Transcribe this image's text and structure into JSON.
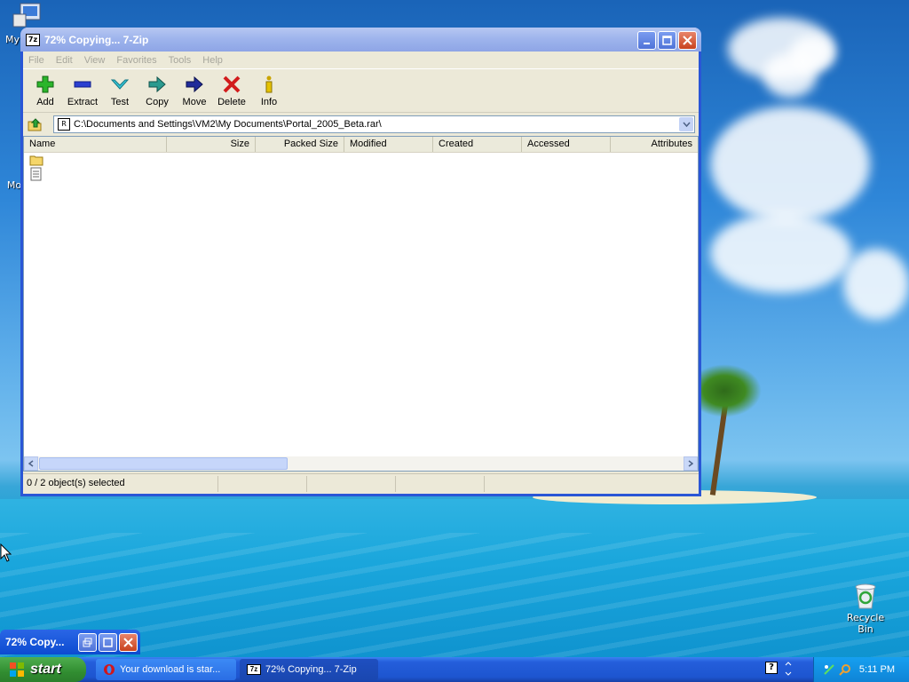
{
  "window": {
    "title": "72% Copying... 7-Zip",
    "app_icon_text": "7z"
  },
  "menu": [
    "File",
    "Edit",
    "View",
    "Favorites",
    "Tools",
    "Help"
  ],
  "toolbar": {
    "add": "Add",
    "extract": "Extract",
    "test": "Test",
    "copy": "Copy",
    "move": "Move",
    "delete": "Delete",
    "info": "Info"
  },
  "address": {
    "path": "C:\\Documents and Settings\\VM2\\My Documents\\Portal_2005_Beta.rar\\"
  },
  "columns": [
    "Name",
    "Size",
    "Packed Size",
    "Modified",
    "Created",
    "Accessed",
    "Attributes"
  ],
  "rows": [
    {
      "icon": "folder-icon"
    },
    {
      "icon": "file-icon"
    }
  ],
  "status": {
    "selection": "0 / 2 object(s) selected"
  },
  "desktop": {
    "my_computer_label": "My",
    "recycle_bin_label": "Recycle Bin",
    "partial_label": "Mo"
  },
  "mini_window": {
    "title": "72% Copy..."
  },
  "taskbar": {
    "start_label": "start",
    "tasks": [
      {
        "label": "Your download is star..."
      },
      {
        "label": "72% Copying... 7-Zip"
      }
    ],
    "clock": "5:11 PM"
  },
  "colors": {
    "titlebar_active": "#2a56d6",
    "taskbar": "#245edb",
    "start_green": "#318d31"
  }
}
